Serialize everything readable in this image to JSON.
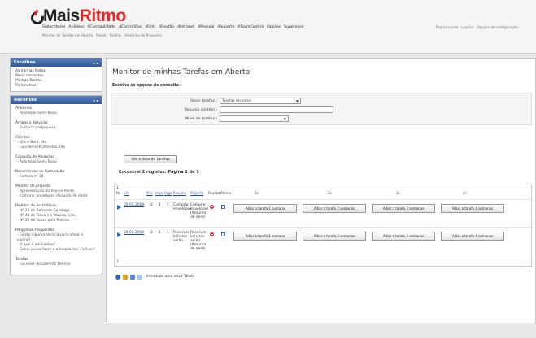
{
  "header": {
    "logo_prefix": "Mais",
    "logo_suffix": "Ritmo",
    "nav": [
      "Subscritores",
      "Análises",
      "dContabilidade",
      "dControlDoc",
      "dCrm",
      "dGestão",
      "dIntranet",
      "dPessoal",
      "dSuporte",
      "dTeamControl",
      "Opções",
      "Supervisor"
    ],
    "subnav": [
      "Monitor de Tarefas em Aberto",
      "Painel",
      "Tarefas",
      "Histórico de Projectos"
    ],
    "toplinks": [
      "Página Inicial",
      "LogOut",
      "Opções de configuração"
    ]
  },
  "sidebar": {
    "escolhas": {
      "title": "Escolhas",
      "items": [
        "As minhas Notas",
        "Meus contactos",
        "Minhas Tarefas",
        "Parâmetros"
      ]
    },
    "recentes": {
      "title": "Recentes",
      "groups": [
        {
          "title": "Anúncios",
          "items": [
            "- Acordeão Semi-Novo"
          ]
        },
        {
          "title": "Artigos e Serviços",
          "items": [
            "- Guitarra portuguesa"
          ]
        },
        {
          "title": "Clientes",
          "items": [
            "- Dra e Bora, lda",
            "- Loja de Instrumentos, lda"
          ]
        },
        {
          "title": "Consulta de Anúncios",
          "items": [
            "- Acordeão Semi-Novo"
          ]
        },
        {
          "title": "Documentos de Facturação",
          "items": [
            "- Factura nº 38"
          ]
        },
        {
          "title": "Monitor de projecto",
          "items": [
            "- Apresentação do Violino Parlet",
            "- Comprar envelopes (Assunto de dem)"
          ]
        },
        {
          "title": "Pedidos de Assistência",
          "items": [
            "- Nº 34 de Bernardo Santiago",
            "- Nº 42 de Trova e a Musica, Lda.",
            "- Nº 35 de Gosto pela Música"
          ]
        },
        {
          "title": "Perguntas Frequentes",
          "items": [
            "- Existe alguma técnica para afinar o violino?",
            "- O que é um violino?",
            "- Como posso fazer a afinação dos violinos?"
          ]
        },
        {
          "title": "Tarefas",
          "items": [
            "- Escrever documento técnico"
          ]
        }
      ]
    }
  },
  "main": {
    "title": "Monitor de minhas Tarefas em Aberto",
    "subtitle": "Escolha as opções de consulta :",
    "filters": {
      "which_label": "Quais tarefas :",
      "which_value": "Tarefas recentes",
      "summary_label": "Resumo contém :",
      "summary_value": "",
      "level_label": "Nível de tarefas :",
      "level_value": ""
    },
    "list_button": "Ver a lista de tarefas",
    "found_text": "Encontrei 2 registos. Página 1 de 1",
    "table": {
      "headers": {
        "nr": "Nr.",
        "date": "Em",
        "prio": "Prio",
        "impo": "Impo",
        "urge": "Urge",
        "summary": "Resumo",
        "project": "Projecto",
        "done": "Realizar",
        "edit": "Alterar",
        "d1": "1s",
        "d2": "2s",
        "d3": "3s",
        "d4": "4s"
      },
      "rows": [
        {
          "date": "20.02.2008",
          "prio": "2",
          "impo": "1",
          "urge": "1",
          "summary": "Comprar envelopes",
          "project": "Comprar envelopes (Assunto de dem)",
          "buttons": [
            "Adiar a tarefa 1 semana",
            "Adiar a tarefa 2 semanas",
            "Adiar a tarefa 3 semanas",
            "Adiar a tarefa 4 semanas"
          ]
        },
        {
          "date": "28.02.2008",
          "prio": "2",
          "impo": "1",
          "urge": "1",
          "summary": "Reservar bilhetes avião",
          "project": "Reservar bilhetes avião (Assunto de dem)",
          "buttons": [
            "Adiar a tarefa 1 semana",
            "Adiar a tarefa 2 semanas",
            "Adiar a tarefa 3 semanas",
            "Adiar a tarefa 4 semanas"
          ]
        }
      ],
      "row_count_label": "1"
    },
    "footer_action": "Introduzir uma nova Tarefa"
  }
}
